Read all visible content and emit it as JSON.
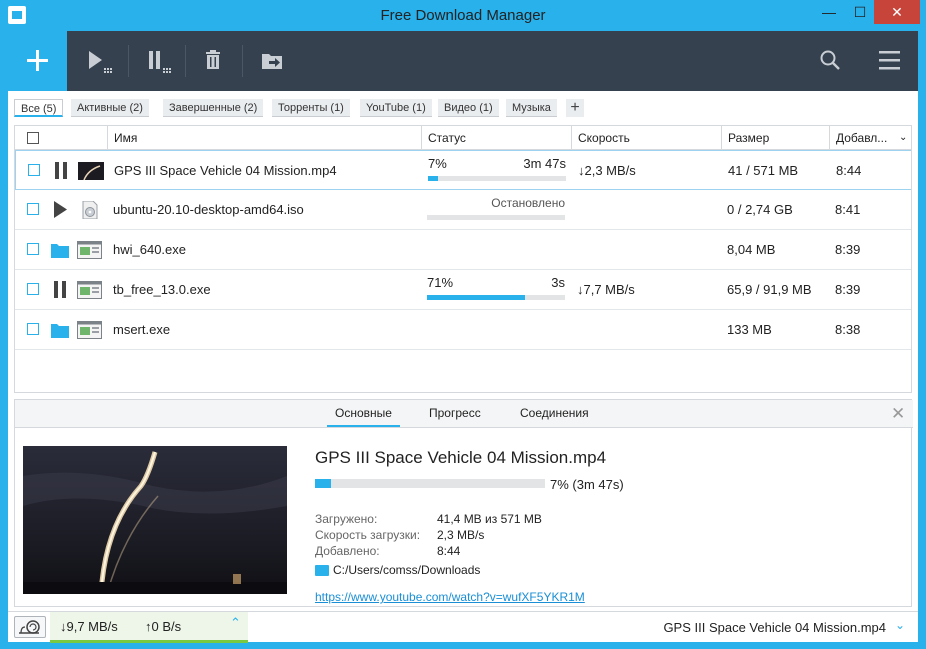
{
  "window": {
    "title": "Free Download Manager",
    "minimize": "—",
    "maximize": "☐",
    "close": "✕"
  },
  "toolbar": {
    "add": "add-download",
    "resume": "resume-all",
    "pause": "pause-all",
    "delete": "delete",
    "move": "move-files",
    "search": "search",
    "menu": "menu"
  },
  "filters": [
    "Все (5)",
    "Активные (2)",
    "Завершенные (2)",
    "Торренты (1)",
    "YouTube (1)",
    "Видео (1)",
    "Музыка"
  ],
  "columns": {
    "name": "Имя",
    "status": "Статус",
    "speed": "Скорость",
    "size": "Размер",
    "added": "Добавл..."
  },
  "downloads": [
    {
      "name": "GPS III Space Vehicle 04 Mission.mp4",
      "state": "downloading",
      "file_icon": "video-thumb",
      "percent": "7%",
      "progress": 0.07,
      "eta": "3m 47s",
      "status_text": "",
      "speed": "↓2,3 MB/s",
      "size": "41 / 571 MB",
      "added": "8:44"
    },
    {
      "name": "ubuntu-20.10-desktop-amd64.iso",
      "state": "stopped",
      "file_icon": "disc-file",
      "percent": "",
      "progress": 0,
      "eta": "",
      "status_text": "Остановлено",
      "speed": "",
      "size": "0 / 2,74 GB",
      "added": "8:41"
    },
    {
      "name": "hwi_640.exe",
      "state": "completed",
      "file_icon": "exe-file",
      "percent": "",
      "progress": null,
      "eta": "",
      "status_text": "",
      "speed": "",
      "size": "8,04 MB",
      "added": "8:39"
    },
    {
      "name": "tb_free_13.0.exe",
      "state": "downloading",
      "file_icon": "exe-file",
      "percent": "71%",
      "progress": 0.71,
      "eta": "3s",
      "status_text": "",
      "speed": "↓7,7 MB/s",
      "size": "65,9 / 91,9 MB",
      "added": "8:39"
    },
    {
      "name": "msert.exe",
      "state": "completed",
      "file_icon": "exe-file",
      "percent": "",
      "progress": null,
      "eta": "",
      "status_text": "",
      "speed": "",
      "size": "133 MB",
      "added": "8:38"
    }
  ],
  "details": {
    "tabs": [
      "Основные",
      "Прогресс",
      "Соединения"
    ],
    "close": "✕",
    "title": "GPS III Space Vehicle 04 Mission.mp4",
    "progress": 0.07,
    "progress_text": "7%  (3m 47s)",
    "downloaded_label": "Загружено:",
    "downloaded_value": "41,4 MB из 571 MB",
    "speed_label": "Скорость загрузки:",
    "speed_value": "2,3 MB/s",
    "added_label": "Добавлено:",
    "added_value": "8:44",
    "path": "C:/Users/comss/Downloads",
    "url": "https://www.youtube.com/watch?v=wufXF5YKR1M"
  },
  "statusbar": {
    "down": "↓9,7 MB/s",
    "up": "↑0 B/s",
    "caret": "⌃",
    "current": "GPS III Space Vehicle 04 Mission.mp4",
    "chevron": "⌄"
  },
  "colors": {
    "accent": "#29b1ec",
    "toolbar": "#35414f",
    "close": "#c7443a",
    "speed_ok": "#7ac943"
  }
}
